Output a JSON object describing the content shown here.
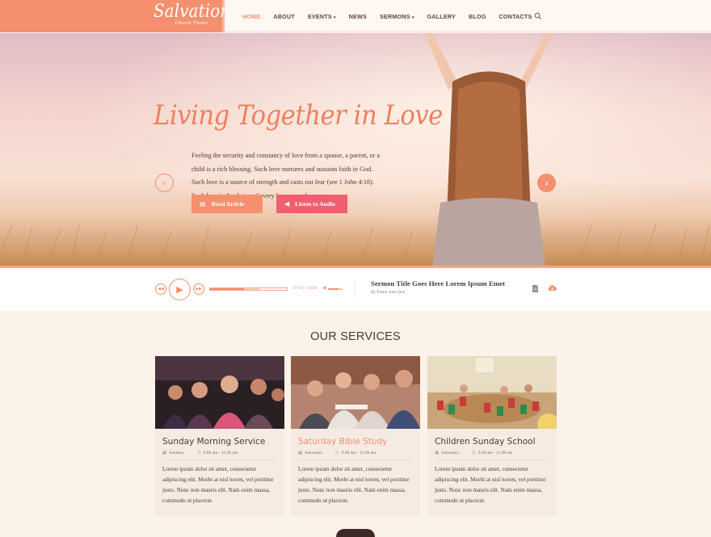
{
  "logo": {
    "name": "Salvation",
    "sub": "Church Theme"
  },
  "nav": [
    {
      "label": "HOME",
      "active": true,
      "caret": false
    },
    {
      "label": "ABOUT",
      "active": false,
      "caret": false
    },
    {
      "label": "EVENTS",
      "active": false,
      "caret": true
    },
    {
      "label": "NEWS",
      "active": false,
      "caret": false
    },
    {
      "label": "SERMONS",
      "active": false,
      "caret": true
    },
    {
      "label": "GALLERY",
      "active": false,
      "caret": false
    },
    {
      "label": "BLOG",
      "active": false,
      "caret": false
    },
    {
      "label": "CONTACTS",
      "active": false,
      "caret": false
    }
  ],
  "hero": {
    "title": "Living Together in Love",
    "text": "Feeling the security and constancy of love from a spouse, a parent, or a child is a rich blessing. Such love nurtures and sustains faith in God. Such love is a source of strength and casts out fear (see 1 John 4:18). Such love is the desire of every human soul.",
    "read_label": "Read Article",
    "listen_label": "Listen to Audio",
    "prev_icon": "chevron-left-icon",
    "next_icon": "chevron-right-icon"
  },
  "player": {
    "time": "07:00 / 16:00",
    "progress": 0.44,
    "buffered": 0.64,
    "volume": 0.7,
    "title": "Sermon Title Goes Here Lorem Ipsum Emet",
    "author": "By Pastor John Doe"
  },
  "services": {
    "title": "OUR SERVICES",
    "cards": [
      {
        "title": "Sunday Morning Service",
        "day": "Sundays",
        "time": "9.00 am - 11.00 am",
        "text": "Lorem ipsum dolor sit amet, consectetur adipiscing elit. Morbi at nisl lorem, vel porttitor justo. Nunc non mauris elit. Nam enim massa, commodo ut placerat.",
        "highlight": false
      },
      {
        "title": "Saturday Bible Study",
        "day": "Saturdays",
        "time": "9.00 am - 11.00 am",
        "text": "Lorem ipsum dolor sit amet, consectetur adipiscing elit. Morbi at nisl lorem, vel porttitor justo. Nunc non mauris elit. Nam enim massa, commodo ut placerat.",
        "highlight": true
      },
      {
        "title": "Children Sunday School",
        "day": "Saturdays",
        "time": "9.00 am - 11.00 am",
        "text": "Lorem ipsum dolor sit amet, consectetur adipiscing elit. Morbi at nisl lorem, vel porttitor justo. Nunc non mauris elit. Nam enim massa, commodo ut placerat.",
        "highlight": false
      }
    ]
  },
  "colors": {
    "accent": "#f58f6d",
    "accent2": "#ef5f6f",
    "bg": "#fbf3ea"
  }
}
